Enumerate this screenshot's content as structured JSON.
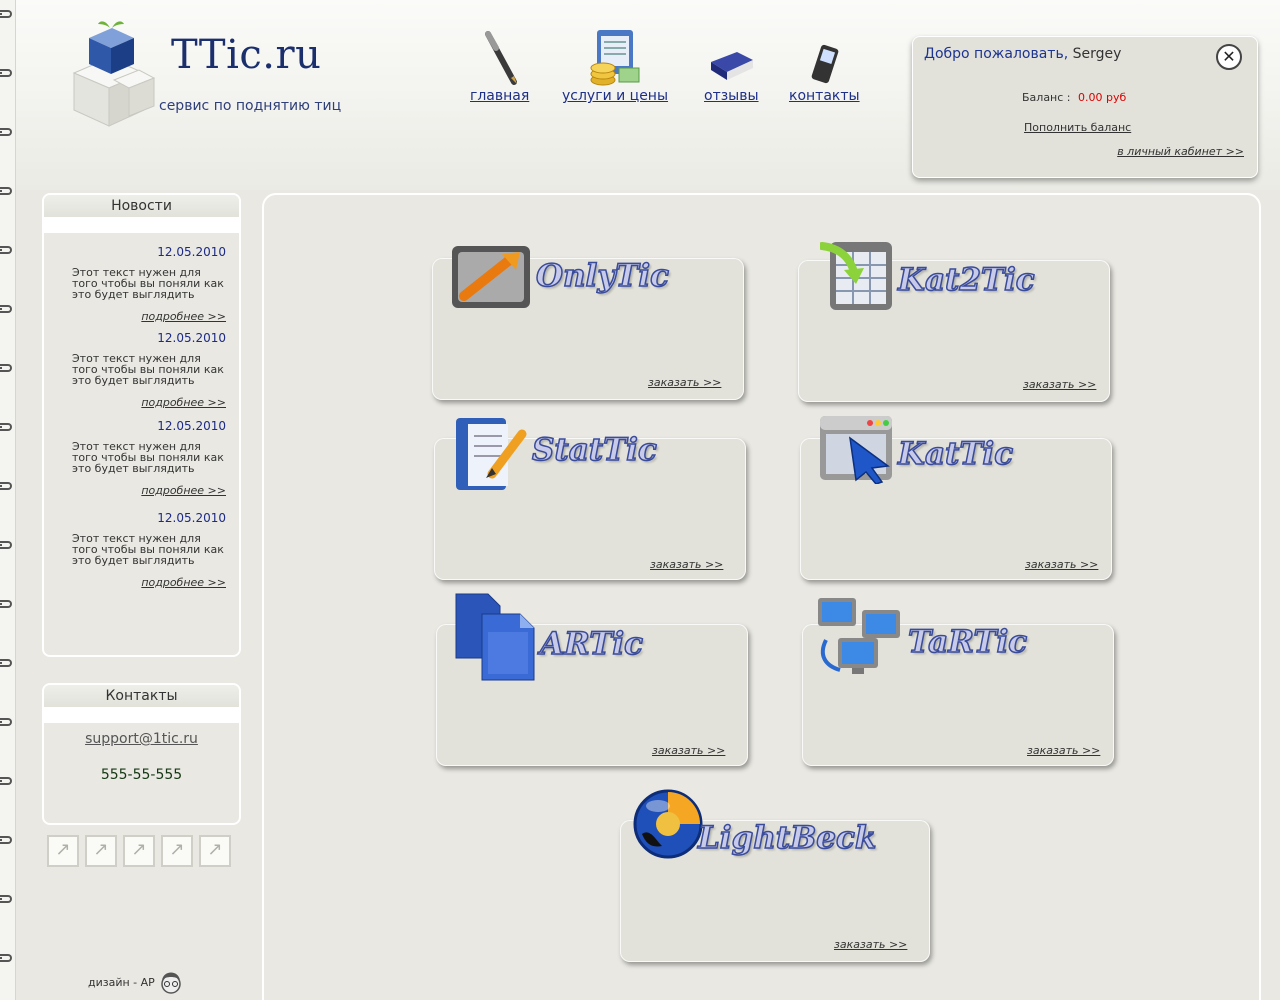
{
  "site": {
    "title": "TTic.ru",
    "tagline": "сервис по поднятию тиц"
  },
  "nav": [
    {
      "label": "главная",
      "icon": "pen-icon"
    },
    {
      "label": "услуги и цены",
      "icon": "coins-icon"
    },
    {
      "label": "отзывы",
      "icon": "book-icon"
    },
    {
      "label": "контакты",
      "icon": "phone-icon"
    }
  ],
  "user": {
    "welcome": "Добро пожаловать,",
    "name": "Sergey",
    "balance_label": "Баланс :",
    "balance_value": "0.00 руб",
    "topup": "Пополнить баланс",
    "cabinet": "в личный кабинет >>"
  },
  "news": {
    "title": "Новости",
    "items": [
      {
        "date": "12.05.2010",
        "text": "Этот текст нужен для того чтобы вы поняли как это будет выглядить",
        "more": "подробнее >>"
      },
      {
        "date": "12.05.2010",
        "text": "Этот текст нужен для того чтобы вы поняли как это будет выглядить",
        "more": "подробнее >>"
      },
      {
        "date": "12.05.2010",
        "text": "Этот текст нужен для того чтобы вы поняли как это будет выглядить",
        "more": "подробнее >>"
      },
      {
        "date": "12.05.2010",
        "text": "Этот текст нужен для того чтобы вы поняли как это будет выглядить",
        "more": "подробнее >>"
      }
    ]
  },
  "contacts": {
    "title": "Контакты",
    "email": "support@1tic.ru",
    "phone": "555-55-555"
  },
  "footer": {
    "design": "дизайн - АР"
  },
  "services": [
    {
      "name": "OnlyTic",
      "order": "заказать >>",
      "icon": "chart-arrow-icon"
    },
    {
      "name": "Kat2Tic",
      "order": "заказать >>",
      "icon": "table-arrow-icon"
    },
    {
      "name": "StatTic",
      "order": "заказать >>",
      "icon": "notebook-pencil-icon"
    },
    {
      "name": "KatTic",
      "order": "заказать >>",
      "icon": "window-cursor-icon"
    },
    {
      "name": "ARTic",
      "order": "заказать >>",
      "icon": "documents-icon"
    },
    {
      "name": "TaRTic",
      "order": "заказать >>",
      "icon": "network-computers-icon"
    },
    {
      "name": "LightBeck",
      "order": "заказать >>",
      "icon": "globe-icon"
    }
  ],
  "colors": {
    "background": "#e9e8e2",
    "link_blue": "#1e2f8a",
    "balance_red": "#dd0000",
    "title_fill": "#c7cbe9",
    "title_stroke": "#3a4b9a"
  }
}
